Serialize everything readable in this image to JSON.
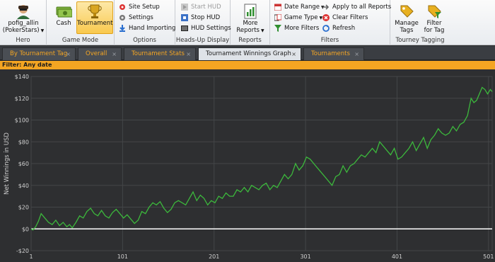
{
  "ribbon": {
    "hero": {
      "name": "pofig_allin",
      "site": "(PokerStars)",
      "label": "Hero"
    },
    "game_mode": {
      "cash": "Cash",
      "tournament": "Tournament",
      "label": "Game Mode"
    },
    "options": {
      "site_setup": "Site Setup",
      "settings": "Settings",
      "hand_importing": "Hand Importing",
      "label": "Options"
    },
    "hud": {
      "start": "Start HUD",
      "stop": "Stop HUD",
      "settings": "HUD Settings",
      "label": "Heads-Up Display"
    },
    "reports": {
      "more_line1": "More",
      "more_line2": "Reports",
      "label": "Reports"
    },
    "filters": {
      "date_range": "Date Range",
      "game_type": "Game Type",
      "more_filters": "More Filters",
      "apply_all": "Apply to all Reports",
      "clear": "Clear Filters",
      "refresh": "Refresh",
      "label": "Filters"
    },
    "tagging": {
      "manage_line1": "Manage",
      "manage_line2": "Tags",
      "filter_line1": "Filter",
      "filter_line2": "for Tag",
      "label": "Tourney Tagging"
    }
  },
  "tabs": [
    {
      "label": "By Tournament Tag",
      "active": false
    },
    {
      "label": "Overall",
      "active": false
    },
    {
      "label": "Tournament Stats",
      "active": false
    },
    {
      "label": "Tournament Winnings Graph",
      "active": true
    },
    {
      "label": "Tournaments",
      "active": false
    }
  ],
  "tab_close": "×",
  "filter": {
    "text": "Filter: Any date"
  },
  "colors": {
    "chart_bg": "#2e2f31",
    "grid": "#444648",
    "line": "#3cb83c",
    "zero_line": "#ffffff",
    "tab_text": "#f5a623",
    "filter_bg": "#f4a522"
  },
  "chart_data": {
    "type": "line",
    "ylabel": "Net Winnings in USD",
    "xlabel": "",
    "x_ticks": [
      "1",
      "101",
      "201",
      "301",
      "401",
      "501"
    ],
    "x_tick_values": [
      1,
      101,
      201,
      301,
      401,
      501
    ],
    "y_ticks": [
      "-$20",
      "$0",
      "$20",
      "$40",
      "$60",
      "$80",
      "$100",
      "$120",
      "$140"
    ],
    "y_tick_values": [
      -20,
      0,
      20,
      40,
      60,
      80,
      100,
      120,
      140
    ],
    "xlim": [
      1,
      505
    ],
    "ylim": [
      -20,
      140
    ],
    "grid": true,
    "series": [
      {
        "x": [
          1,
          3,
          6,
          9,
          12,
          16,
          20,
          24,
          28,
          32,
          36,
          40,
          43,
          46,
          50,
          54,
          58,
          62,
          66,
          70,
          74,
          78,
          82,
          86,
          90,
          94,
          98,
          102,
          106,
          110,
          114,
          118,
          122,
          126,
          130,
          134,
          138,
          142,
          146,
          150,
          154,
          158,
          162,
          166,
          170,
          174,
          178,
          182,
          186,
          190,
          194,
          198,
          202,
          206,
          210,
          214,
          218,
          222,
          226,
          230,
          234,
          238,
          242,
          246,
          250,
          254,
          258,
          262,
          266,
          270,
          274,
          278,
          282,
          286,
          290,
          294,
          298,
          302,
          306,
          310,
          314,
          318,
          322,
          326,
          330,
          334,
          338,
          342,
          346,
          350,
          354,
          358,
          362,
          366,
          370,
          374,
          378,
          382,
          386,
          390,
          394,
          398,
          402,
          406,
          410,
          414,
          418,
          422,
          426,
          430,
          434,
          438,
          442,
          446,
          450,
          454,
          458,
          462,
          466,
          470,
          474,
          478,
          482,
          485,
          488,
          491,
          494,
          497,
          500,
          503,
          505
        ],
        "y": [
          0,
          -1,
          2,
          7,
          14,
          10,
          6,
          4,
          8,
          3,
          6,
          2,
          4,
          1,
          6,
          12,
          10,
          16,
          19,
          14,
          12,
          17,
          12,
          10,
          15,
          18,
          14,
          10,
          13,
          9,
          5,
          8,
          16,
          14,
          20,
          24,
          22,
          25,
          19,
          15,
          18,
          24,
          26,
          24,
          22,
          28,
          34,
          26,
          31,
          28,
          22,
          26,
          24,
          30,
          28,
          33,
          30,
          30,
          36,
          34,
          38,
          34,
          40,
          38,
          36,
          40,
          42,
          36,
          40,
          38,
          44,
          50,
          46,
          50,
          60,
          54,
          58,
          66,
          64,
          60,
          56,
          52,
          48,
          44,
          40,
          48,
          50,
          58,
          52,
          58,
          60,
          64,
          68,
          66,
          70,
          74,
          70,
          80,
          76,
          72,
          68,
          74,
          64,
          66,
          70,
          74,
          80,
          72,
          78,
          84,
          74,
          82,
          86,
          92,
          88,
          86,
          88,
          94,
          90,
          96,
          98,
          104,
          120,
          116,
          118,
          124,
          130,
          128,
          124,
          128,
          126
        ]
      }
    ]
  }
}
